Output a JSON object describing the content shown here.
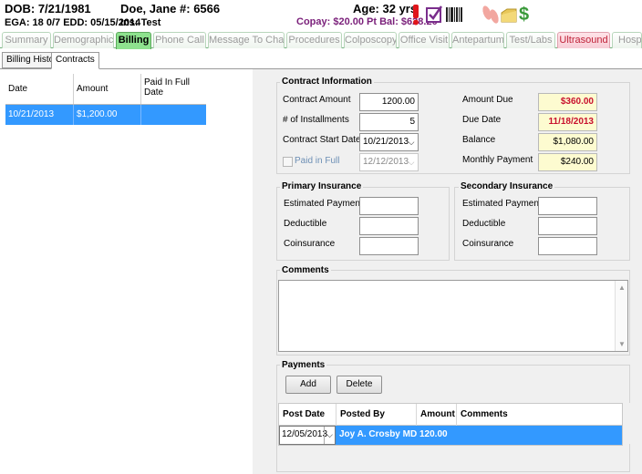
{
  "header": {
    "dob": "DOB: 7/21/1981",
    "ega": "EGA: 18 0/7  EDD: 05/15/2014",
    "patient": "Doe, Jane #: 6566",
    "insurance": "Ins: Test",
    "age": "Age: 32 yrs",
    "copay": "Copay: $20.00 Pt Bal: $628.20",
    "icons": [
      "alert-exclamation-icon",
      "checkbox-icon",
      "barcode-icon",
      "feet-icon",
      "folder-icon",
      "dollar-icon"
    ]
  },
  "tabs": [
    {
      "label": "Summary",
      "state": "normal"
    },
    {
      "label": "Demographics",
      "state": "normal"
    },
    {
      "label": "Billing",
      "state": "active"
    },
    {
      "label": "Phone Call",
      "state": "normal"
    },
    {
      "label": "Message To Chart",
      "state": "normal"
    },
    {
      "label": "Procedures",
      "state": "normal"
    },
    {
      "label": "Colposcopy",
      "state": "normal"
    },
    {
      "label": "Office Visit",
      "state": "normal"
    },
    {
      "label": "Antepartum",
      "state": "normal"
    },
    {
      "label": "Test/Labs",
      "state": "normal"
    },
    {
      "label": "Ultrasound",
      "state": "alert"
    },
    {
      "label": "Hospit",
      "state": "normal"
    }
  ],
  "subtabs": [
    "Billing History",
    "Contracts"
  ],
  "contracts_grid": {
    "headers": [
      "Date",
      "Amount",
      "Paid In Full Date"
    ],
    "rows": [
      {
        "date": "10/21/2013",
        "amount": "$1,200.00",
        "paid_in_full_date": ""
      }
    ]
  },
  "contract_info": {
    "title": "Contract Information",
    "contract_amount_label": "Contract Amount",
    "contract_amount": "1200.00",
    "installments_label": "# of Installments",
    "installments": "5",
    "start_date_label": "Contract Start Date",
    "start_date": "10/21/2013",
    "paid_in_full_label": "Paid in Full",
    "paid_in_full_date": "12/12/2013",
    "amount_due_label": "Amount Due",
    "amount_due": "$360.00",
    "due_date_label": "Due Date",
    "due_date": "11/18/2013",
    "balance_label": "Balance",
    "balance": "$1,080.00",
    "monthly_payment_label": "Monthly Payment",
    "monthly_payment": "$240.00"
  },
  "primary_insurance": {
    "title": "Primary Insurance",
    "estimated_payment_label": "Estimated Payment",
    "deductible_label": "Deductible",
    "coinsurance_label": "Coinsurance"
  },
  "secondary_insurance": {
    "title": "Secondary Insurance",
    "estimated_payment_label": "Estimated Payment",
    "deductible_label": "Deductible",
    "coinsurance_label": "Coinsurance"
  },
  "comments": {
    "title": "Comments",
    "value": ""
  },
  "payments": {
    "title": "Payments",
    "add_label": "Add",
    "delete_label": "Delete",
    "headers": [
      "Post Date",
      "Posted By",
      "Amount",
      "Comments"
    ],
    "rows": [
      {
        "post_date": "12/05/2013",
        "posted_by": "Joy A. Crosby MD",
        "amount": "120.00",
        "comments": ""
      }
    ]
  }
}
